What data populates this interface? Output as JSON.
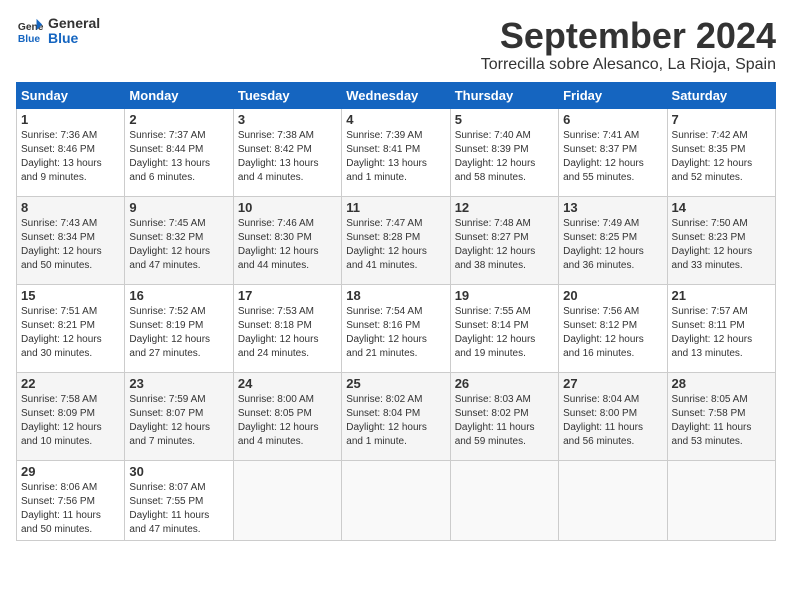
{
  "header": {
    "logo_line1": "General",
    "logo_line2": "Blue",
    "month_title": "September 2024",
    "location": "Torrecilla sobre Alesanco, La Rioja, Spain"
  },
  "days_of_week": [
    "Sunday",
    "Monday",
    "Tuesday",
    "Wednesday",
    "Thursday",
    "Friday",
    "Saturday"
  ],
  "weeks": [
    [
      {
        "day": "1",
        "info": "Sunrise: 7:36 AM\nSunset: 8:46 PM\nDaylight: 13 hours\nand 9 minutes."
      },
      {
        "day": "2",
        "info": "Sunrise: 7:37 AM\nSunset: 8:44 PM\nDaylight: 13 hours\nand 6 minutes."
      },
      {
        "day": "3",
        "info": "Sunrise: 7:38 AM\nSunset: 8:42 PM\nDaylight: 13 hours\nand 4 minutes."
      },
      {
        "day": "4",
        "info": "Sunrise: 7:39 AM\nSunset: 8:41 PM\nDaylight: 13 hours\nand 1 minute."
      },
      {
        "day": "5",
        "info": "Sunrise: 7:40 AM\nSunset: 8:39 PM\nDaylight: 12 hours\nand 58 minutes."
      },
      {
        "day": "6",
        "info": "Sunrise: 7:41 AM\nSunset: 8:37 PM\nDaylight: 12 hours\nand 55 minutes."
      },
      {
        "day": "7",
        "info": "Sunrise: 7:42 AM\nSunset: 8:35 PM\nDaylight: 12 hours\nand 52 minutes."
      }
    ],
    [
      {
        "day": "8",
        "info": "Sunrise: 7:43 AM\nSunset: 8:34 PM\nDaylight: 12 hours\nand 50 minutes."
      },
      {
        "day": "9",
        "info": "Sunrise: 7:45 AM\nSunset: 8:32 PM\nDaylight: 12 hours\nand 47 minutes."
      },
      {
        "day": "10",
        "info": "Sunrise: 7:46 AM\nSunset: 8:30 PM\nDaylight: 12 hours\nand 44 minutes."
      },
      {
        "day": "11",
        "info": "Sunrise: 7:47 AM\nSunset: 8:28 PM\nDaylight: 12 hours\nand 41 minutes."
      },
      {
        "day": "12",
        "info": "Sunrise: 7:48 AM\nSunset: 8:27 PM\nDaylight: 12 hours\nand 38 minutes."
      },
      {
        "day": "13",
        "info": "Sunrise: 7:49 AM\nSunset: 8:25 PM\nDaylight: 12 hours\nand 36 minutes."
      },
      {
        "day": "14",
        "info": "Sunrise: 7:50 AM\nSunset: 8:23 PM\nDaylight: 12 hours\nand 33 minutes."
      }
    ],
    [
      {
        "day": "15",
        "info": "Sunrise: 7:51 AM\nSunset: 8:21 PM\nDaylight: 12 hours\nand 30 minutes."
      },
      {
        "day": "16",
        "info": "Sunrise: 7:52 AM\nSunset: 8:19 PM\nDaylight: 12 hours\nand 27 minutes."
      },
      {
        "day": "17",
        "info": "Sunrise: 7:53 AM\nSunset: 8:18 PM\nDaylight: 12 hours\nand 24 minutes."
      },
      {
        "day": "18",
        "info": "Sunrise: 7:54 AM\nSunset: 8:16 PM\nDaylight: 12 hours\nand 21 minutes."
      },
      {
        "day": "19",
        "info": "Sunrise: 7:55 AM\nSunset: 8:14 PM\nDaylight: 12 hours\nand 19 minutes."
      },
      {
        "day": "20",
        "info": "Sunrise: 7:56 AM\nSunset: 8:12 PM\nDaylight: 12 hours\nand 16 minutes."
      },
      {
        "day": "21",
        "info": "Sunrise: 7:57 AM\nSunset: 8:11 PM\nDaylight: 12 hours\nand 13 minutes."
      }
    ],
    [
      {
        "day": "22",
        "info": "Sunrise: 7:58 AM\nSunset: 8:09 PM\nDaylight: 12 hours\nand 10 minutes."
      },
      {
        "day": "23",
        "info": "Sunrise: 7:59 AM\nSunset: 8:07 PM\nDaylight: 12 hours\nand 7 minutes."
      },
      {
        "day": "24",
        "info": "Sunrise: 8:00 AM\nSunset: 8:05 PM\nDaylight: 12 hours\nand 4 minutes."
      },
      {
        "day": "25",
        "info": "Sunrise: 8:02 AM\nSunset: 8:04 PM\nDaylight: 12 hours\nand 1 minute."
      },
      {
        "day": "26",
        "info": "Sunrise: 8:03 AM\nSunset: 8:02 PM\nDaylight: 11 hours\nand 59 minutes."
      },
      {
        "day": "27",
        "info": "Sunrise: 8:04 AM\nSunset: 8:00 PM\nDaylight: 11 hours\nand 56 minutes."
      },
      {
        "day": "28",
        "info": "Sunrise: 8:05 AM\nSunset: 7:58 PM\nDaylight: 11 hours\nand 53 minutes."
      }
    ],
    [
      {
        "day": "29",
        "info": "Sunrise: 8:06 AM\nSunset: 7:56 PM\nDaylight: 11 hours\nand 50 minutes."
      },
      {
        "day": "30",
        "info": "Sunrise: 8:07 AM\nSunset: 7:55 PM\nDaylight: 11 hours\nand 47 minutes."
      },
      {
        "day": "",
        "info": ""
      },
      {
        "day": "",
        "info": ""
      },
      {
        "day": "",
        "info": ""
      },
      {
        "day": "",
        "info": ""
      },
      {
        "day": "",
        "info": ""
      }
    ]
  ]
}
